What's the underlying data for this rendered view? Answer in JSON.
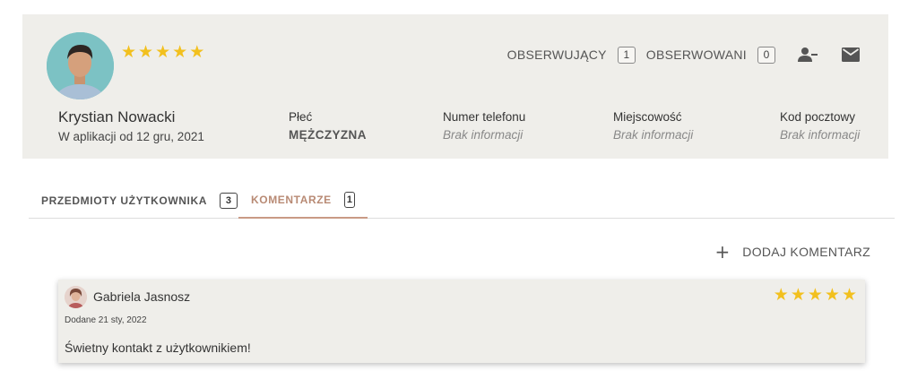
{
  "profile": {
    "name": "Krystian Nowacki",
    "joined": "W aplikacji od 12 gru, 2021",
    "rating": 5,
    "stars": [
      "★",
      "★",
      "★",
      "★",
      "★"
    ],
    "followers_label": "OBSERWUJĄCY",
    "followers_count": "1",
    "following_label": "OBSERWOWANI",
    "following_count": "0",
    "icons": [
      "remove-user-icon",
      "mail-icon"
    ]
  },
  "fields": {
    "gender": {
      "label": "Płeć",
      "value": "MĘŻCZYZNA"
    },
    "phone": {
      "label": "Numer telefonu",
      "value": "Brak informacji"
    },
    "city": {
      "label": "Miejscowość",
      "value": "Brak informacji"
    },
    "postal": {
      "label": "Kod pocztowy",
      "value": "Brak informacji"
    }
  },
  "tabs": [
    {
      "label": "PRZEDMIOTY UŻYTKOWNIKA",
      "count": "3",
      "active": false
    },
    {
      "label": "KOMENTARZE",
      "count": "1",
      "active": true
    }
  ],
  "add_comment": {
    "icon": "plus-icon",
    "plus": "+",
    "label": "DODAJ KOMENTARZ"
  },
  "comments": [
    {
      "author": "Gabriela Jasnosz",
      "date": "Dodane 21 sty, 2022",
      "text": "Świetny kontakt z użytkownikiem!",
      "rating": 5,
      "stars": [
        "★",
        "★",
        "★",
        "★",
        "★"
      ]
    }
  ],
  "colors": {
    "star": "#f2c01e",
    "card_bg": "#efeeea",
    "active_tab": "#b88a74"
  }
}
